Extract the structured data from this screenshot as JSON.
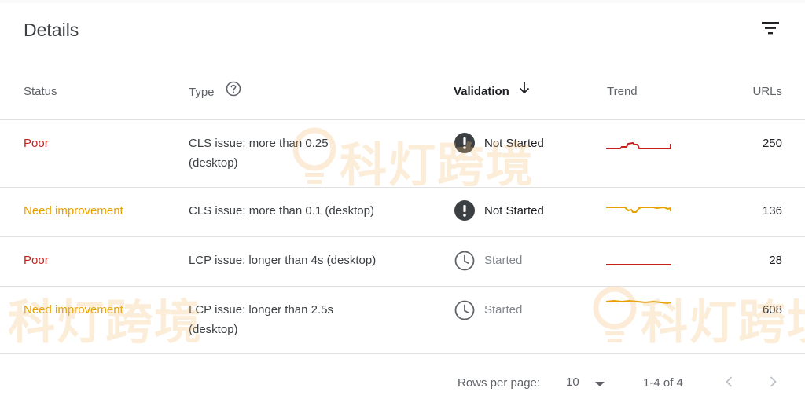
{
  "panel": {
    "title": "Details"
  },
  "columns": {
    "status": "Status",
    "type": "Type",
    "validation": "Validation",
    "trend": "Trend",
    "urls": "URLs"
  },
  "rows": [
    {
      "status": "Poor",
      "status_color": "#c5221f",
      "type": "CLS issue: more than 0.25 (desktop)",
      "validation": "Not Started",
      "validation_icon": "exclamation-icon",
      "trend_color": "#c5221f",
      "urls": "250"
    },
    {
      "status": "Need improvement",
      "status_color": "#e8a000",
      "type": "CLS issue: more than 0.1 (desktop)",
      "validation": "Not Started",
      "validation_icon": "exclamation-icon",
      "trend_color": "#e8a000",
      "urls": "136"
    },
    {
      "status": "Poor",
      "status_color": "#c5221f",
      "type": "LCP issue: longer than 4s (desktop)",
      "validation": "Started",
      "validation_icon": "clock-icon",
      "trend_color": "#c5221f",
      "urls": "28"
    },
    {
      "status": "Need improvement",
      "status_color": "#e8a000",
      "type": "LCP issue: longer than 2.5s (desktop)",
      "validation": "Started",
      "validation_icon": "clock-icon",
      "trend_color": "#e8a000",
      "urls": "608"
    }
  ],
  "pagination": {
    "rows_per_page_label": "Rows per page:",
    "rows_per_page_value": "10",
    "range": "1-4 of 4"
  },
  "watermark": {
    "text": "科灯跨境"
  }
}
